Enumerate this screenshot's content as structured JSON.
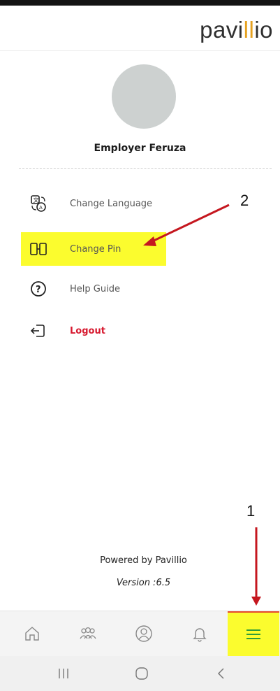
{
  "header": {
    "logo_start": "pavi",
    "logo_ll": "ll",
    "logo_end": "io"
  },
  "profile": {
    "name": "Employer Feruza"
  },
  "menu": {
    "change_language": "Change Language",
    "change_pin": "Change Pin",
    "help_guide": "Help Guide",
    "logout": "Logout"
  },
  "annotations": {
    "arrow_1": "1",
    "arrow_2": "2"
  },
  "footer": {
    "powered_by": "Powered by Pavillio",
    "version": "Version :6.5"
  },
  "bottom_nav": [
    "home-icon",
    "team-icon",
    "profile-icon",
    "bell-icon",
    "menu-icon"
  ],
  "system_nav": [
    "recent-apps-icon",
    "home-circle-icon",
    "back-icon"
  ],
  "colors": {
    "highlight": "#fbfc2e",
    "logout": "#d7192f",
    "active_nav": "#2e9c3a",
    "arrow": "#c5171f",
    "brand_accent": "#e6a11f"
  }
}
